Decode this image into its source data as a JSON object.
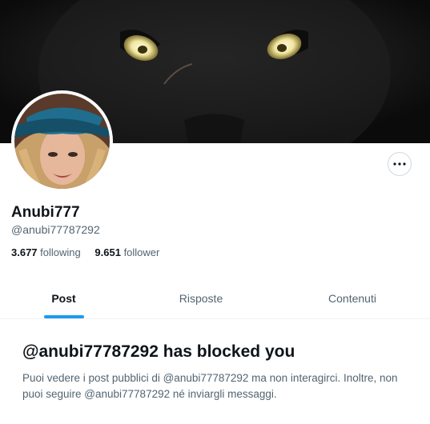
{
  "profile": {
    "display_name": "Anubi777",
    "handle": "@anubi77787292",
    "following_count": "3.677",
    "following_label": "following",
    "followers_count": "9.651",
    "followers_label": "follower"
  },
  "header": {
    "banner_icon": "black-panther-image",
    "more_icon": "more-horizontal-icon"
  },
  "tabs": [
    {
      "label": "Post",
      "active": true
    },
    {
      "label": "Risposte",
      "active": false
    },
    {
      "label": "Contenuti",
      "active": false
    }
  ],
  "blocked": {
    "title": "@anubi77787292 has blocked you",
    "text": "Puoi vedere i post pubblici di @anubi77787292 ma non interagirci. Inoltre, non puoi seguire @anubi77787292 né inviargli messaggi."
  },
  "colors": {
    "accent": "#1d9bf0",
    "text_primary": "#0f1419",
    "text_secondary": "#536471",
    "border": "#cfd9de"
  }
}
